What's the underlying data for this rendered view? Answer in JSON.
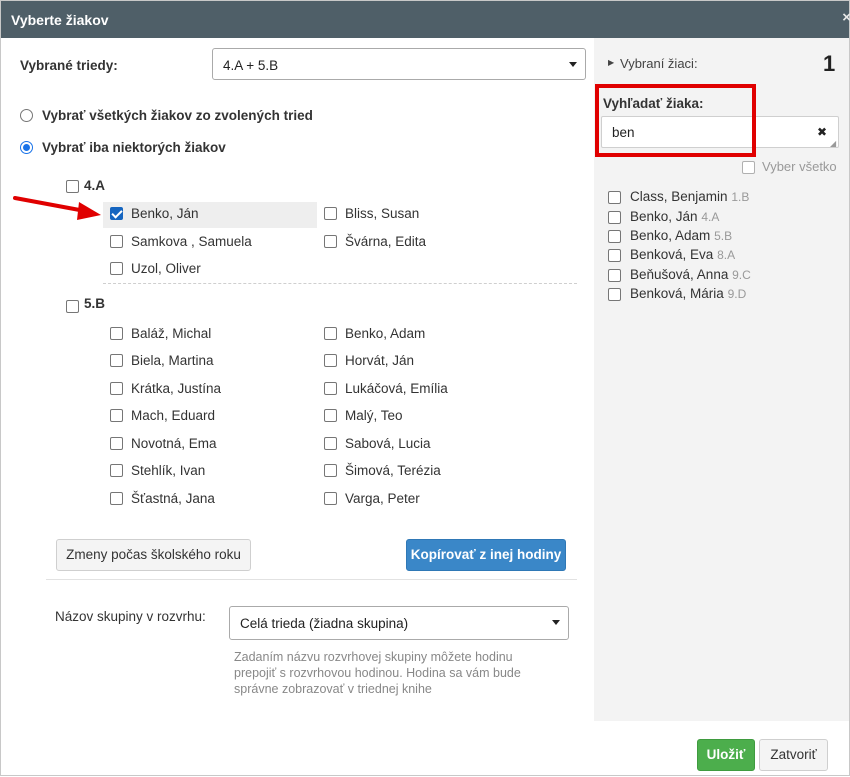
{
  "dialog": {
    "title": "Vyberte žiakov",
    "close_glyph": "×"
  },
  "classes_field": {
    "label": "Vybrané triedy:",
    "value": "4.A + 5.B"
  },
  "mode_options": [
    {
      "label": "Vybrať všetkých žiakov zo zvolených tried",
      "checked": false
    },
    {
      "label": "Vybrať iba niektorých žiakov",
      "checked": true
    }
  ],
  "groups": [
    {
      "name": "4.A",
      "students": [
        {
          "name": "Benko, Ján",
          "checked": true
        },
        {
          "name": "Bliss, Susan",
          "checked": false
        },
        {
          "name": "Samkova , Samuela",
          "checked": false
        },
        {
          "name": "Švárna, Edita",
          "checked": false
        },
        {
          "name": "Uzol, Oliver",
          "checked": false
        }
      ]
    },
    {
      "name": "5.B",
      "students": [
        {
          "name": "Baláž, Michal",
          "checked": false
        },
        {
          "name": "Benko, Adam",
          "checked": false
        },
        {
          "name": "Biela, Martina",
          "checked": false
        },
        {
          "name": "Horvát, Ján",
          "checked": false
        },
        {
          "name": "Krátka, Justína",
          "checked": false
        },
        {
          "name": "Lukáčová, Emília",
          "checked": false
        },
        {
          "name": "Mach, Eduard",
          "checked": false
        },
        {
          "name": "Malý, Teo",
          "checked": false
        },
        {
          "name": "Novotná, Ema",
          "checked": false
        },
        {
          "name": "Sabová, Lucia",
          "checked": false
        },
        {
          "name": "Stehlík, Ivan",
          "checked": false
        },
        {
          "name": "Šimová, Terézia",
          "checked": false
        },
        {
          "name": "Šťastná, Jana",
          "checked": false
        },
        {
          "name": "Varga, Peter",
          "checked": false
        }
      ]
    }
  ],
  "buttons": {
    "changes": "Zmeny počas školského roku",
    "copy": "Kopírovať z inej hodiny",
    "save": "Uložiť",
    "close": "Zatvoriť"
  },
  "group_field": {
    "label": "Názov skupiny v rozvrhu:",
    "value": "Celá trieda (žiadna skupina)",
    "help": [
      "Zadaním názvu rozvrhovej skupiny môžete hodinu",
      "prepojiť s rozvrhovou hodinou. Hodina sa vám bude",
      "správne zobrazovať v triednej knihe"
    ]
  },
  "selected_panel": {
    "label": "Vybraní žiaci:",
    "count": "1"
  },
  "search": {
    "label": "Vyhľadať žiaka:",
    "value": "ben",
    "clear_glyph": "✖",
    "select_all_label": "Vyber všetko"
  },
  "search_results": [
    {
      "name": "Class, Benjamin",
      "class": "1.B"
    },
    {
      "name": "Benko, Ján",
      "class": "4.A"
    },
    {
      "name": "Benko, Adam",
      "class": "5.B"
    },
    {
      "name": "Benková, Eva",
      "class": "8.A"
    },
    {
      "name": "Beňušová, Anna",
      "class": "9.C"
    },
    {
      "name": "Benková, Mária",
      "class": "9.D"
    }
  ],
  "colors": {
    "titlebar": "#4f5f68",
    "primary": "#3a87c8",
    "success": "#4cae4c",
    "highlight": "#e00000"
  }
}
